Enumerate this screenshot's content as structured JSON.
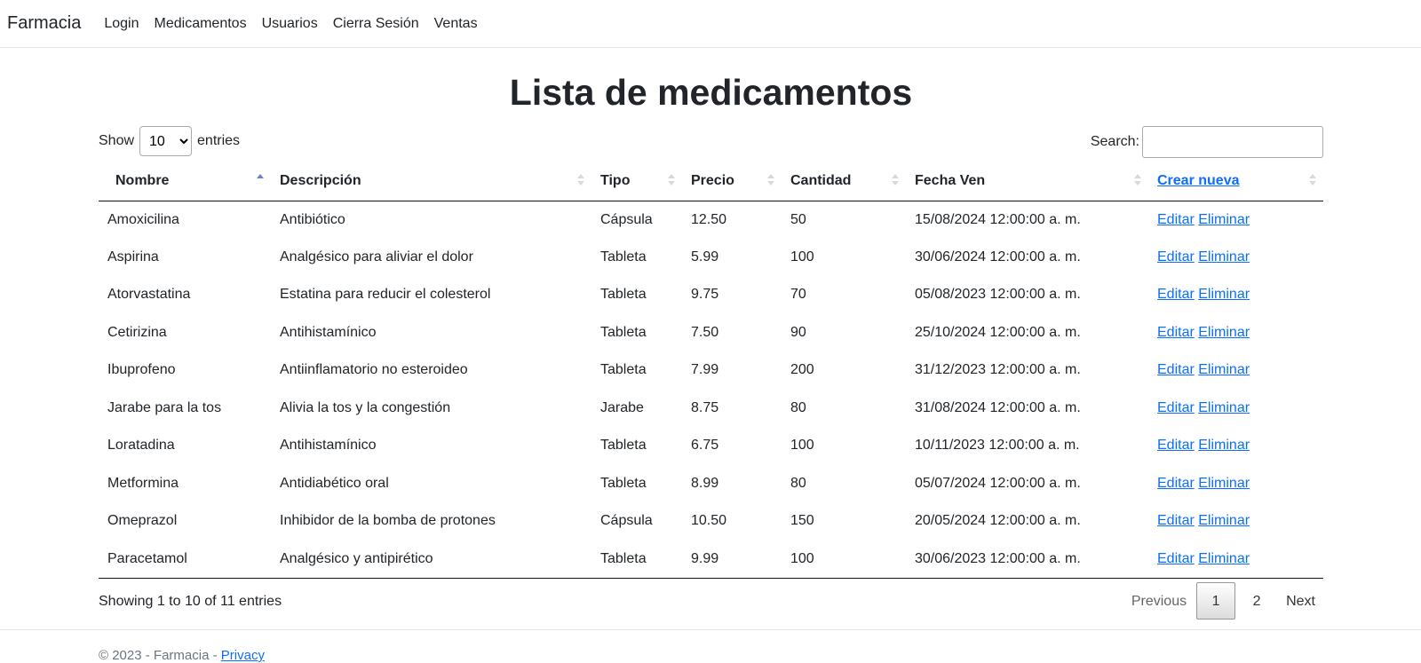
{
  "navbar": {
    "brand": "Farmacia",
    "links": [
      "Login",
      "Medicamentos",
      "Usuarios",
      "Cierra Sesión",
      "Ventas"
    ]
  },
  "page": {
    "title": "Lista de medicamentos"
  },
  "length_control": {
    "show_label": "Show",
    "selected": "10",
    "options": [
      "10"
    ],
    "entries_label": "entries"
  },
  "search": {
    "label": "Search:",
    "value": ""
  },
  "table": {
    "columns": [
      "Nombre",
      "Descripción",
      "Tipo",
      "Precio",
      "Cantidad",
      "Fecha Ven"
    ],
    "create_link": "Crear nueva",
    "sorted_column": "Nombre",
    "sort_direction": "asc",
    "action_edit": "Editar",
    "action_delete": "Eliminar",
    "rows": [
      [
        "Amoxicilina",
        "Antibiótico",
        "Cápsula",
        "12.50",
        "50",
        "15/08/2024 12:00:00 a. m."
      ],
      [
        "Aspirina",
        "Analgésico para aliviar el dolor",
        "Tableta",
        "5.99",
        "100",
        "30/06/2024 12:00:00 a. m."
      ],
      [
        "Atorvastatina",
        "Estatina para reducir el colesterol",
        "Tableta",
        "9.75",
        "70",
        "05/08/2023 12:00:00 a. m."
      ],
      [
        "Cetirizina",
        "Antihistamínico",
        "Tableta",
        "7.50",
        "90",
        "25/10/2024 12:00:00 a. m."
      ],
      [
        "Ibuprofeno",
        "Antiinflamatorio no esteroideo",
        "Tableta",
        "7.99",
        "200",
        "31/12/2023 12:00:00 a. m."
      ],
      [
        "Jarabe para la tos",
        "Alivia la tos y la congestión",
        "Jarabe",
        "8.75",
        "80",
        "31/08/2024 12:00:00 a. m."
      ],
      [
        "Loratadina",
        "Antihistamínico",
        "Tableta",
        "6.75",
        "100",
        "10/11/2023 12:00:00 a. m."
      ],
      [
        "Metformina",
        "Antidiabético oral",
        "Tableta",
        "8.99",
        "80",
        "05/07/2024 12:00:00 a. m."
      ],
      [
        "Omeprazol",
        "Inhibidor de la bomba de protones",
        "Cápsula",
        "10.50",
        "150",
        "20/05/2024 12:00:00 a. m."
      ],
      [
        "Paracetamol",
        "Analgésico y antipirético",
        "Tableta",
        "9.99",
        "100",
        "30/06/2023 12:00:00 a. m."
      ]
    ]
  },
  "info": "Showing 1 to 10 of 11 entries",
  "pagination": {
    "previous": "Previous",
    "pages": [
      "1",
      "2"
    ],
    "current": "1",
    "next": "Next"
  },
  "footer": {
    "text": "© 2023 - Farmacia - ",
    "link": "Privacy"
  },
  "colors": {
    "link": "#0d6efd",
    "sort_active": "#6b7fd1",
    "text": "#212529"
  }
}
